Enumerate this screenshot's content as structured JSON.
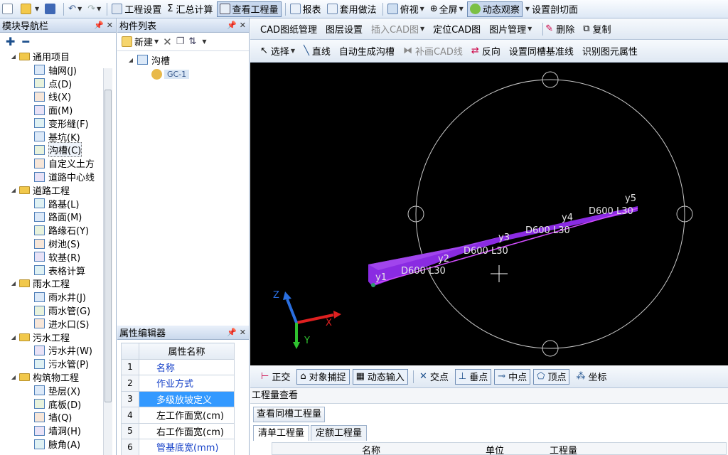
{
  "toolbar": {
    "project_settings": "工程设置",
    "summary_calc": "汇总计算",
    "view_quantity": "查看工程量",
    "report": "报表",
    "apply_method": "套用做法",
    "top_view": "俯视",
    "full_screen": "全屏",
    "dynamic_observe": "动态观察",
    "set_section": "设置剖切面"
  },
  "nav": {
    "title": "模块导航栏",
    "groups": [
      {
        "label": "通用项目",
        "items": [
          "轴网(J)",
          "点(D)",
          "线(X)",
          "面(M)",
          "变形缝(F)",
          "基坑(K)",
          "沟槽(C)",
          "自定义土方",
          "道路中心线"
        ]
      },
      {
        "label": "道路工程",
        "items": [
          "路基(L)",
          "路面(M)",
          "路缘石(Y)",
          "树池(S)",
          "软基(R)",
          "表格计算"
        ]
      },
      {
        "label": "雨水工程",
        "items": [
          "雨水井(J)",
          "雨水管(G)",
          "进水口(S)"
        ]
      },
      {
        "label": "污水工程",
        "items": [
          "污水井(W)",
          "污水管(P)"
        ]
      },
      {
        "label": "构筑物工程",
        "items": [
          "垫层(X)",
          "底板(D)",
          "墙(Q)",
          "墙洞(H)",
          "腋角(A)"
        ]
      }
    ]
  },
  "complist": {
    "title": "构件列表",
    "new_label": "新建",
    "root": "沟槽",
    "child": "GC-1"
  },
  "props": {
    "title": "属性编辑器",
    "header": "属性名称",
    "rows": [
      {
        "num": "1",
        "name": "名称"
      },
      {
        "num": "2",
        "name": "作业方式"
      },
      {
        "num": "3",
        "name": "多级放坡定义"
      },
      {
        "num": "4",
        "name": "左工作面宽(cm)"
      },
      {
        "num": "5",
        "name": "右工作面宽(cm)"
      },
      {
        "num": "6",
        "name": "管基底宽(mm)"
      }
    ]
  },
  "ribbon1": {
    "cad_manage": "CAD图纸管理",
    "layer_settings": "图层设置",
    "insert_cad": "插入CAD图",
    "locate_cad": "定位CAD图",
    "image_manage": "图片管理",
    "delete": "删除",
    "copy": "复制"
  },
  "ribbon2": {
    "select": "选择",
    "straight": "直线",
    "auto_gen": "自动生成沟槽",
    "redraw_cad": "补画CAD线",
    "reverse": "反向",
    "set_baseline": "设置同槽基准线",
    "identify_attr": "识别图元属性"
  },
  "canvas": {
    "points": [
      "y1",
      "y2",
      "y3",
      "y4",
      "y5"
    ],
    "pipe_label": "D600 L30",
    "axis_x": "X",
    "axis_y": "Y",
    "axis_z": "Z"
  },
  "snapbar": {
    "ortho": "正交",
    "object_snap": "对象捕捉",
    "dynamic_input": "动态输入",
    "intersection": "交点",
    "perpendicular": "垂点",
    "midpoint": "中点",
    "vertex": "顶点",
    "coordinate": "坐标"
  },
  "qty": {
    "title": "工程量查看",
    "same_groove": "查看同槽工程量",
    "tab_list": "清单工程量",
    "tab_quota": "定额工程量",
    "col_name": "名称",
    "col_unit": "单位",
    "col_amount": "工程量"
  },
  "colors": {
    "pipe": "#8a2be2",
    "canvas_bg": "#000000",
    "highlight": "#3399ff"
  }
}
